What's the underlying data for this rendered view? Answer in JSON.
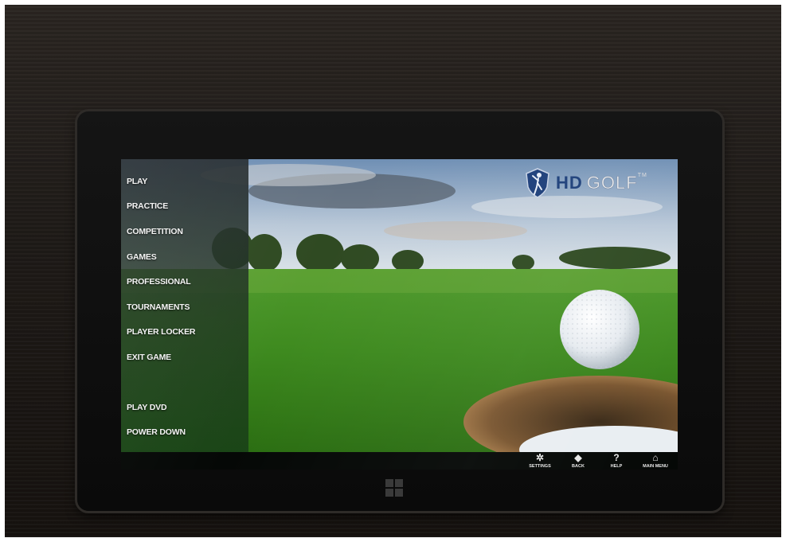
{
  "brand": {
    "logo_hd": "HD",
    "logo_golf": "GOLF",
    "logo_tm": "TM"
  },
  "menu": {
    "items": [
      {
        "label": "PLAY"
      },
      {
        "label": "PRACTICE"
      },
      {
        "label": "COMPETITION"
      },
      {
        "label": "GAMES"
      },
      {
        "label": "PROFESSIONAL"
      },
      {
        "label": "TOURNAMENTS"
      },
      {
        "label": "PLAYER LOCKER"
      },
      {
        "label": "EXIT GAME"
      },
      {
        "label": "PLAY DVD"
      },
      {
        "label": "POWER DOWN"
      }
    ]
  },
  "toolbar": {
    "settings": {
      "icon": "gear-icon",
      "glyph": "✲",
      "label": "SETTINGS"
    },
    "back": {
      "icon": "back-arrow-icon",
      "glyph": "◆",
      "label": "BACK"
    },
    "help": {
      "icon": "question-icon",
      "glyph": "?",
      "label": "HELP"
    },
    "main_menu": {
      "icon": "home-icon",
      "glyph": "⌂",
      "label": "MAIN MENU"
    }
  },
  "colors": {
    "brand_blue": "#1d3f7a",
    "menu_text": "#f4f4f4"
  }
}
